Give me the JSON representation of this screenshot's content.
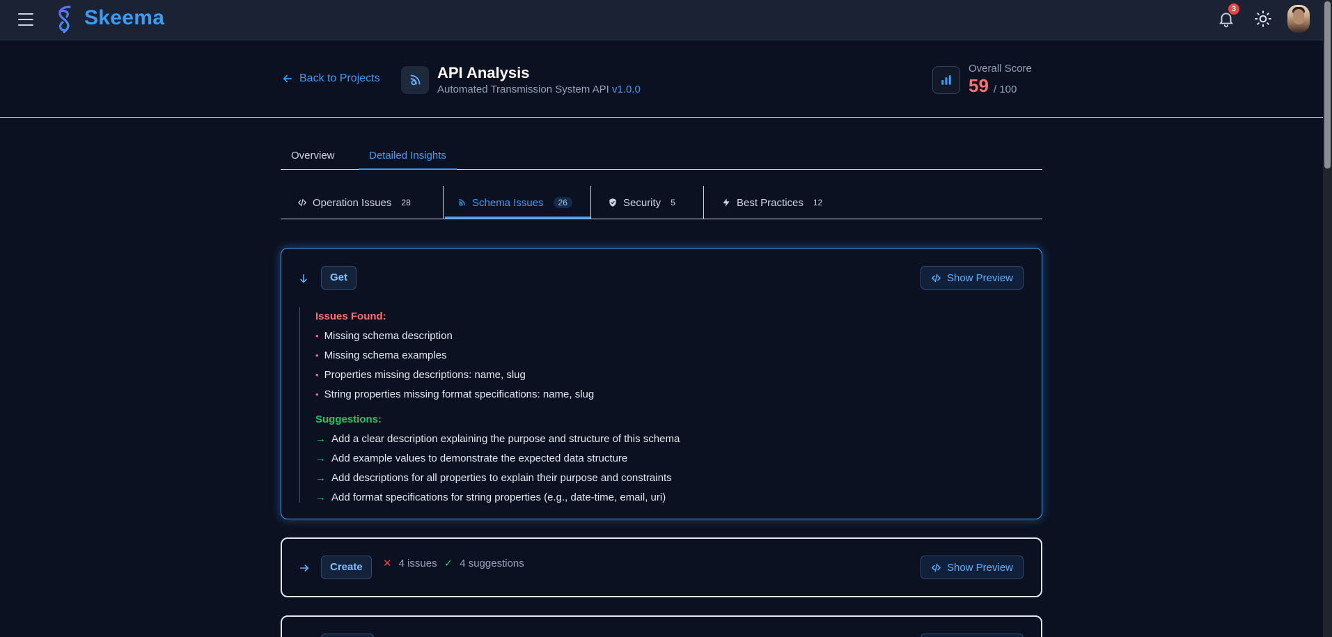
{
  "app": {
    "brand": "Skeema",
    "notification_count": "3",
    "colors": {
      "accent": "#3b9cf5",
      "danger": "#f87171",
      "success": "#22c55e",
      "background": "#0b1120"
    }
  },
  "header": {
    "back_label": "Back to Projects",
    "title": "API Analysis",
    "subtitle": "Automated Transmission System API",
    "version": "v1.0.0",
    "score_label": "Overall Score",
    "score_value": "59",
    "score_max": "/ 100"
  },
  "main_tabs": [
    {
      "label": "Overview"
    },
    {
      "label": "Detailed Insights"
    }
  ],
  "sub_tabs": [
    {
      "label": "Operation Issues",
      "count": "28",
      "icon": "code-icon"
    },
    {
      "label": "Schema Issues",
      "count": "26",
      "icon": "schema-icon"
    },
    {
      "label": "Security",
      "count": "5",
      "icon": "shield-icon"
    },
    {
      "label": "Best Practices",
      "count": "12",
      "icon": "lightning-icon"
    }
  ],
  "cards": [
    {
      "method": "Get",
      "preview_label": "Show Preview",
      "issues_title": "Issues Found:",
      "issues": [
        "Missing schema description",
        "Missing schema examples",
        "Properties missing descriptions: name, slug",
        "String properties missing format specifications: name, slug"
      ],
      "suggestions_title": "Suggestions:",
      "suggestions": [
        "Add a clear description explaining the purpose and structure of this schema",
        "Add example values to demonstrate the expected data structure",
        "Add descriptions for all properties to explain their purpose and constraints",
        "Add format specifications for string properties (e.g., date-time, email, uri)"
      ]
    },
    {
      "method": "Create",
      "issues_summary": "4 issues",
      "suggestions_summary": "4 suggestions",
      "preview_label": "Show Preview"
    }
  ]
}
